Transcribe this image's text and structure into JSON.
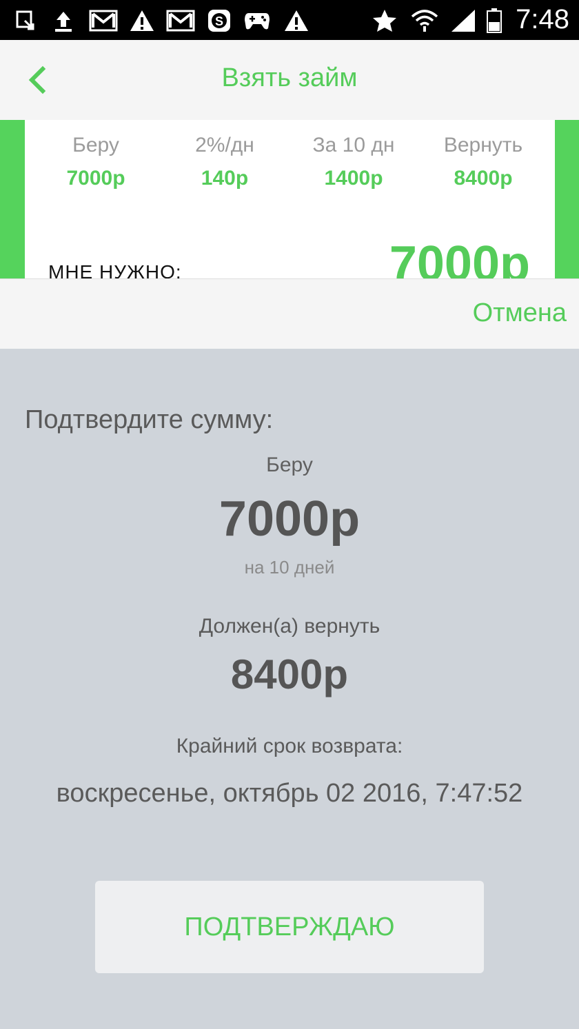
{
  "status_bar": {
    "time": "7:48",
    "icons": [
      "download-icon",
      "upload-icon",
      "gmail-icon",
      "warning-icon",
      "gmail-icon",
      "skype-icon",
      "gamepad-icon",
      "warning-icon",
      "star-icon",
      "wifi-icon",
      "signal-icon",
      "battery-icon"
    ]
  },
  "header": {
    "title": "Взять займ",
    "back_icon": "chevron-left-icon"
  },
  "summary": {
    "items": [
      {
        "label": "Беру",
        "value": "7000р"
      },
      {
        "label": "2%/дн",
        "value": "140р"
      },
      {
        "label": "За 10 дн",
        "value": "1400р"
      },
      {
        "label": "Вернуть",
        "value": "8400р"
      }
    ],
    "need_label": "МНЕ НУЖНО:",
    "need_value": "7000р"
  },
  "cancel_label": "Отмена",
  "confirm": {
    "title": "Подтвердите сумму:",
    "take_label": "Беру",
    "take_value": "7000р",
    "days": "на 10 дней",
    "return_label": "Должен(а) вернуть",
    "return_value": "8400р",
    "deadline_label": "Крайний срок возврата:",
    "deadline_value": "воскресенье, октябрь 02 2016, 7:47:52",
    "button_label": "ПОДТВЕРЖДАЮ"
  },
  "colors": {
    "accent": "#55cc5a",
    "overlay": "#cfd4da"
  }
}
